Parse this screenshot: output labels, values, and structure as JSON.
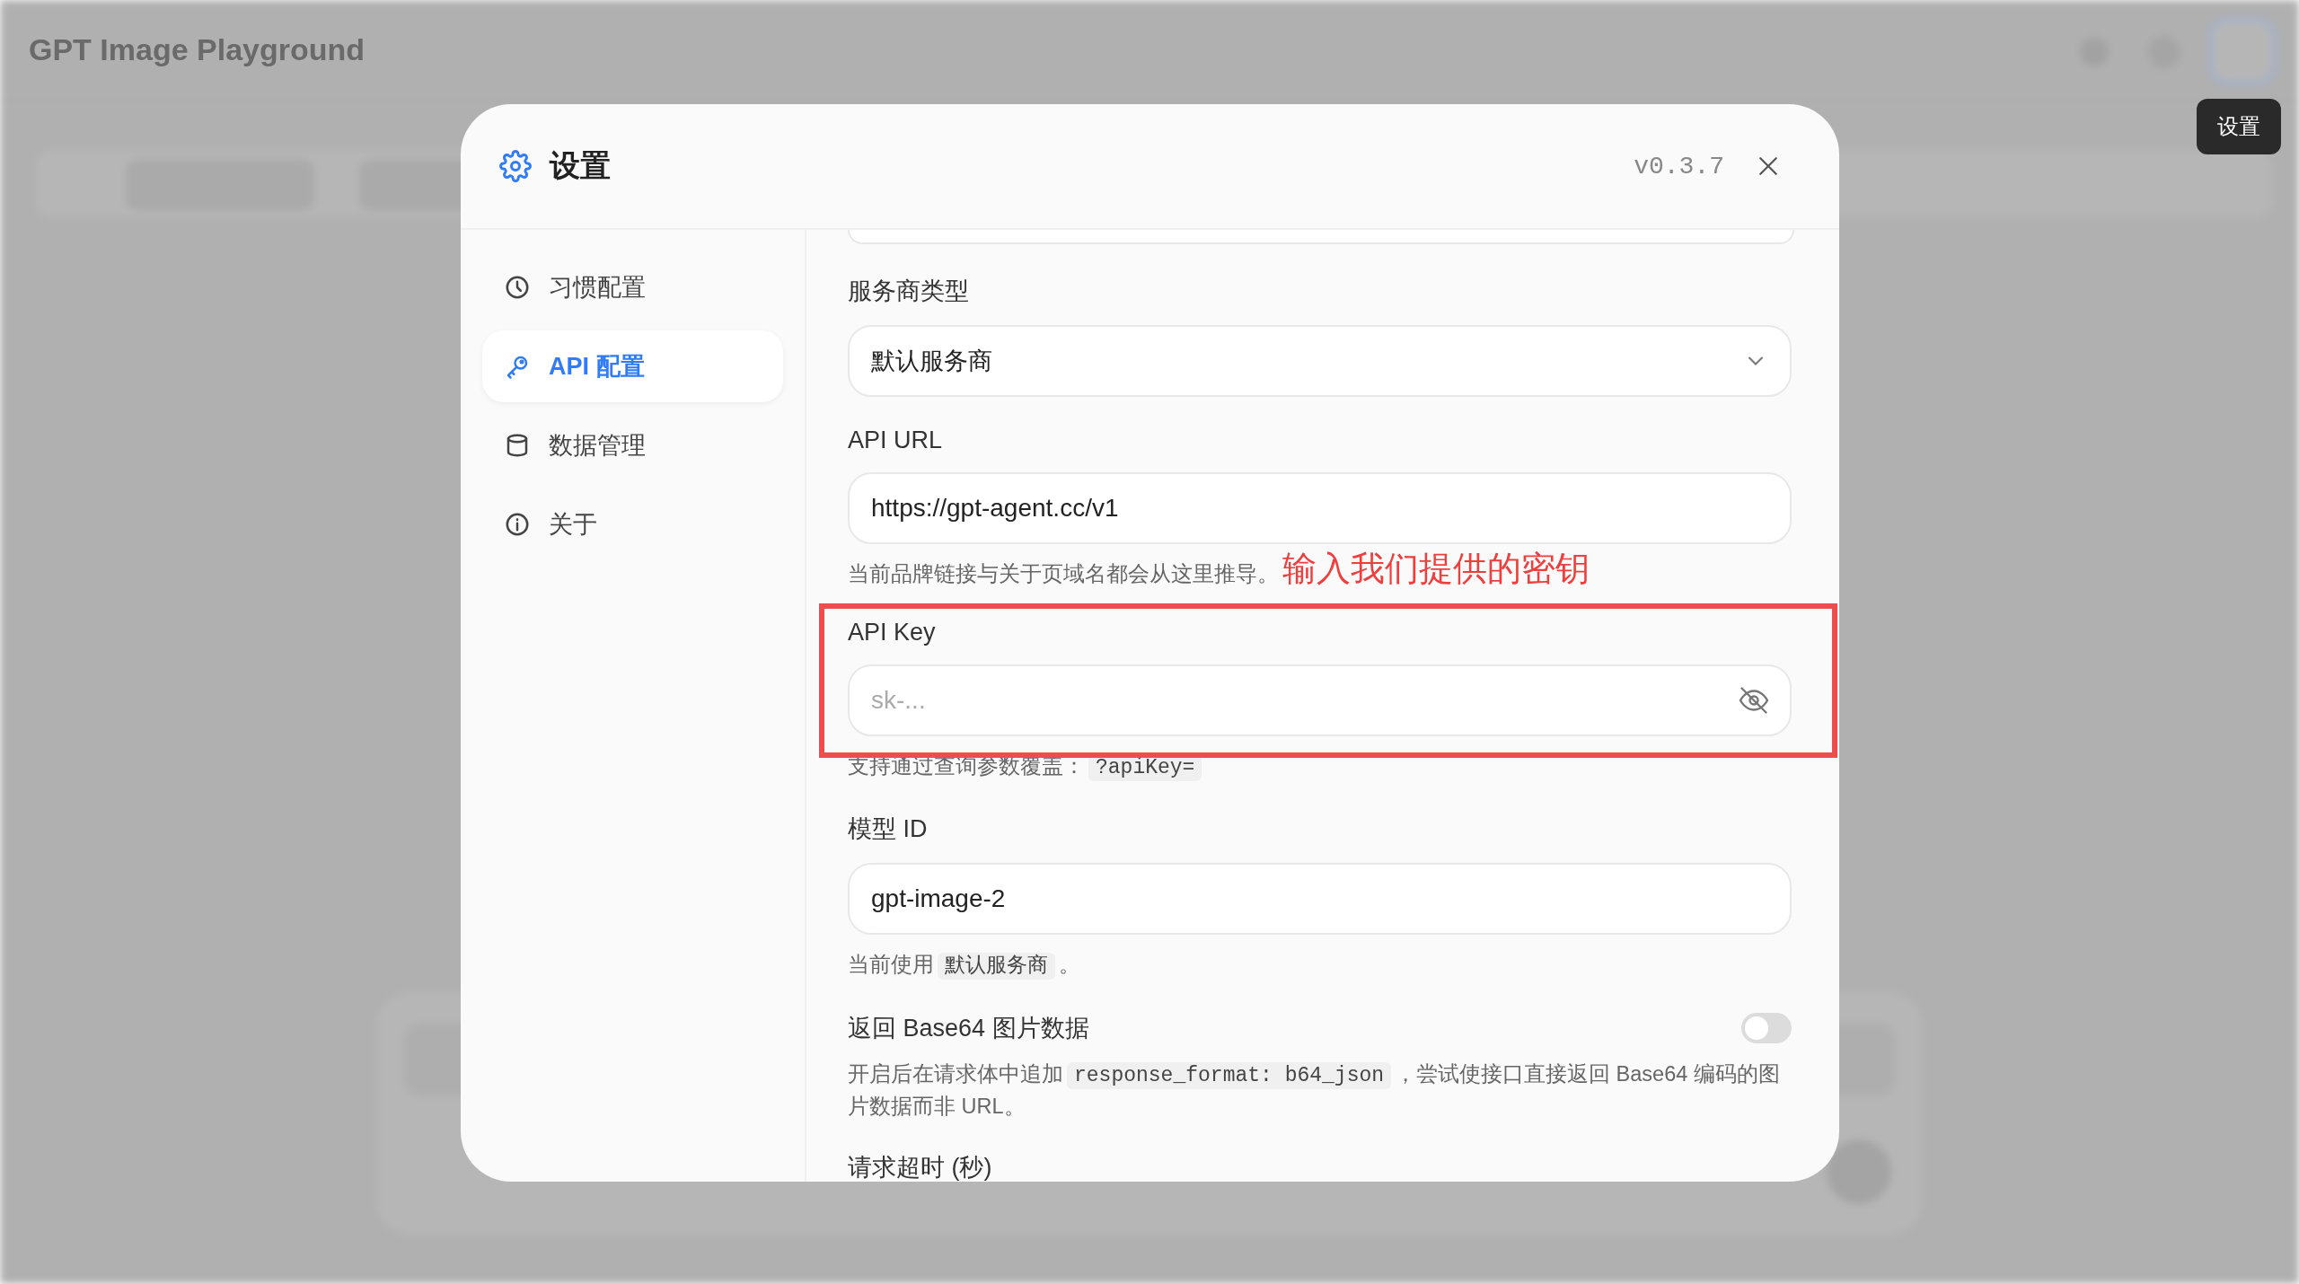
{
  "app": {
    "title": "GPT Image Playground"
  },
  "tooltip": {
    "text": "设置"
  },
  "dialog": {
    "title": "设置",
    "version": "v0.3.7"
  },
  "nav": [
    {
      "label": "习惯配置",
      "selected": false
    },
    {
      "label": "API 配置",
      "selected": true
    },
    {
      "label": "数据管理",
      "selected": false
    },
    {
      "label": "关于",
      "selected": false
    }
  ],
  "fields": [
    {
      "kind": "cut"
    },
    {
      "kind": "select",
      "label": "服务商类型",
      "value": "默认服务商"
    },
    {
      "kind": "text",
      "label": "API URL",
      "value": "https://gpt-agent.cc/v1",
      "hint": [
        {
          "kind": "text",
          "text": "当前品牌链接与关于页域名都会从这里推导。"
        }
      ]
    },
    {
      "kind": "secret",
      "label": "API Key",
      "placeholder": "sk-...",
      "hint": [
        {
          "kind": "text",
          "text": "支持通过查询参数覆盖："
        },
        {
          "kind": "code",
          "text": "?apiKey="
        }
      ]
    },
    {
      "kind": "text",
      "label": "模型 ID",
      "value": "gpt-image-2",
      "hint": [
        {
          "kind": "text",
          "text": "当前使用"
        },
        {
          "kind": "code",
          "text": "默认服务商"
        },
        {
          "kind": "text",
          "text": "。"
        }
      ]
    },
    {
      "kind": "toggle",
      "label": "返回 Base64 图片数据",
      "on": false,
      "hint": [
        {
          "kind": "text",
          "text": "开启后在请求体中追加"
        },
        {
          "kind": "code",
          "text": "response_format: b64_json"
        },
        {
          "kind": "text",
          "text": "，尝试使接口直接返回 Base64 编码的图片数据而非 URL。"
        }
      ]
    },
    {
      "kind": "heading",
      "label": "请求超时 (秒)"
    }
  ],
  "annotation": {
    "text": "输入我们提供的密钥"
  }
}
